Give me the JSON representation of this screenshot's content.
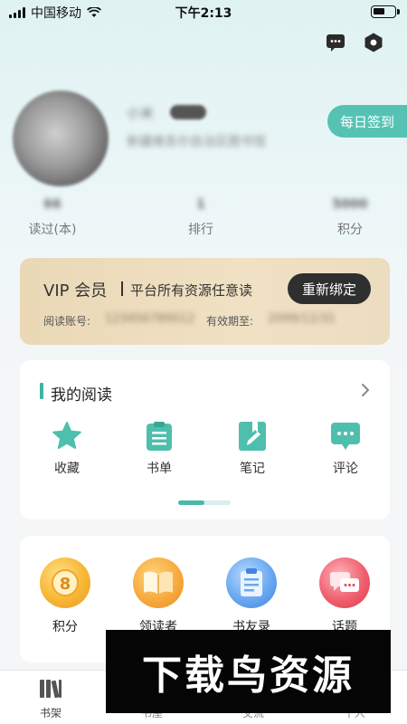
{
  "status_bar": {
    "carrier": "中国移动",
    "time": "下午2:13"
  },
  "header": {
    "message_icon": "message-dots-icon",
    "settings_icon": "hexagon-settings-icon",
    "username_blurred": "小米",
    "tag_blurred": "",
    "org_blurred": "新疆维吾尔自治区图书馆",
    "checkin_label": "每日签到"
  },
  "stats": [
    {
      "value": "66",
      "label": "读过(本)"
    },
    {
      "value": "1",
      "label": "排行"
    },
    {
      "value": "5000",
      "label": "积分"
    }
  ],
  "vip": {
    "title": "VIP 会员",
    "desc": "平台所有资源任意读",
    "rebind_label": "重新绑定",
    "account_label": "阅读账号:",
    "account_value": "123456789012",
    "expiry_label": "有效期至:",
    "expiry_value": "2099/12/31"
  },
  "my_reading": {
    "title": "我的阅读",
    "items": [
      {
        "label": "收藏",
        "icon": "star-icon"
      },
      {
        "label": "书单",
        "icon": "clipboard-list-icon"
      },
      {
        "label": "笔记",
        "icon": "note-pen-icon"
      },
      {
        "label": "评论",
        "icon": "comment-bubble-icon"
      }
    ],
    "pager_progress": 0.5
  },
  "features": [
    {
      "label": "积分",
      "icon": "points-coin-icon",
      "color": "#f5a623"
    },
    {
      "label": "领读者",
      "icon": "open-book-icon",
      "color": "#f39c2b"
    },
    {
      "label": "书友录",
      "icon": "clipboard-icon",
      "color": "#4a90e2"
    },
    {
      "label": "话题",
      "icon": "chat-bubbles-icon",
      "color": "#e8485a"
    }
  ],
  "tabbar": [
    {
      "label": "书架",
      "icon": "bookshelf-icon",
      "active": true
    },
    {
      "label": "书屋",
      "icon": "house-icon",
      "active": false
    },
    {
      "label": "交流",
      "icon": "chat-icon",
      "active": false
    },
    {
      "label": "个人",
      "icon": "person-icon",
      "active": false
    }
  ],
  "colors": {
    "accent": "#3cb5a3",
    "checkin_bg": "#56c2b4",
    "vip_bg": "#efdfc2",
    "rebind_bg": "#2f2f2f"
  },
  "watermark": "下载鸟资源"
}
